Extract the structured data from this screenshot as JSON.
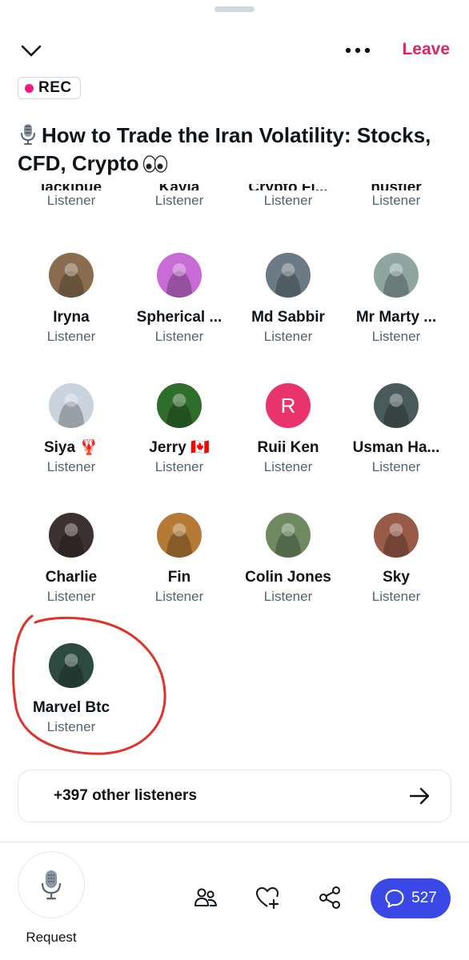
{
  "header": {
    "leave_label": "Leave",
    "rec_label": "REC",
    "title_text": "How to Trade the Iran Volatility: Stocks, CFD, Crypto"
  },
  "cutoff_row": [
    {
      "name": "lackibue",
      "role": "Listener"
    },
    {
      "name": "Kayla",
      "role": "Listener"
    },
    {
      "name": "Crypto Fi...",
      "role": "Listener"
    },
    {
      "name": "hustler",
      "role": "Listener"
    }
  ],
  "listeners": [
    {
      "name": "Iryna",
      "role": "Listener",
      "color": "#8a6d4e"
    },
    {
      "name": "Spherical ...",
      "role": "Listener",
      "color": "#c86bd6"
    },
    {
      "name": "Md Sabbir",
      "role": "Listener",
      "color": "#6b7a84"
    },
    {
      "name": "Mr Marty ...",
      "role": "Listener",
      "color": "#8fa6a0"
    },
    {
      "name": "Siya 🦞",
      "role": "Listener",
      "color": "#c9d4df"
    },
    {
      "name": "Jerry 🇨🇦",
      "role": "Listener",
      "color": "#2f6d2a"
    },
    {
      "name": "Ruii Ken",
      "role": "Listener",
      "color": "#e8336d",
      "initial": "R"
    },
    {
      "name": "Usman Ha...",
      "role": "Listener",
      "color": "#4a5a5a"
    },
    {
      "name": "Charlie",
      "role": "Listener",
      "color": "#3a3130"
    },
    {
      "name": "Fin",
      "role": "Listener",
      "color": "#b57a36"
    },
    {
      "name": "Colin Jones",
      "role": "Listener",
      "color": "#6f8a63"
    },
    {
      "name": "Sky",
      "role": "Listener",
      "color": "#9a5a48"
    },
    {
      "name": "Marvel Btc",
      "role": "Listener",
      "color": "#2d4a40"
    }
  ],
  "others": {
    "label": "+397 other listeners"
  },
  "footer": {
    "request_label": "Request",
    "chat_count": "527"
  },
  "colors": {
    "leave": "#e0245e",
    "rec_dot": "#f91880",
    "chat_button": "#3a49e6",
    "secondary_text": "#536471",
    "annotation": "#e0322a"
  },
  "icons": [
    "chevron-down-icon",
    "more-icon",
    "microphone-icon",
    "eyes-icon",
    "arrow-right-icon",
    "people-icon",
    "heart-add-icon",
    "share-icon",
    "chat-icon"
  ]
}
